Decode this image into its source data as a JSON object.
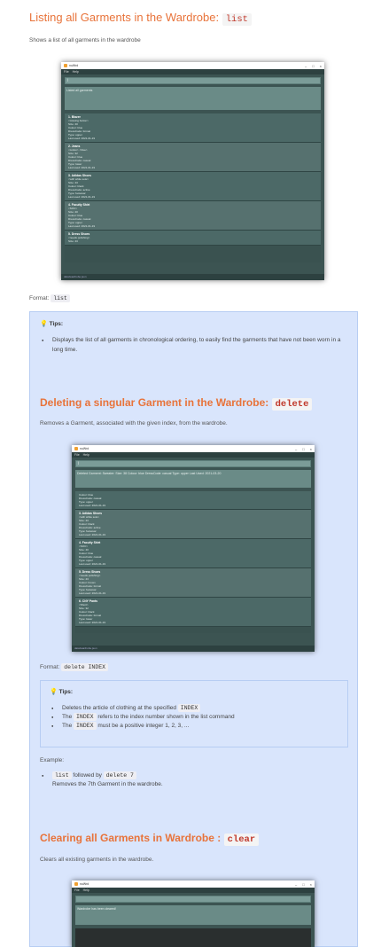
{
  "section_list": {
    "title": "Listing all Garments in the Wardrobe: ",
    "command": "list",
    "description": "Shows a list of all garments in the wardrobe",
    "format_label": "Format:",
    "format_cmd": "list",
    "tips_label": "Tips:",
    "tips": [
      "Displays the list of all garments in chronological ordering, to easily find the garments that have not been worn in a long time."
    ]
  },
  "screenshot_list": {
    "title": "nuWrd",
    "menu": [
      "File",
      "Help"
    ],
    "command_text": "|",
    "result_text": "Listed all garments",
    "cards": [
      {
        "name": "1.  Blazer",
        "lines": [
          "<missing button>",
          "Size: 40",
          "Colour: blue",
          "DressCode: formal",
          "Type: upper",
          "Last used: 2021-01-19"
        ]
      },
      {
        "name": "2.  Jeans",
        "lines": [
          "<cotton> <blue>",
          "Size: 32",
          "Colour: blue",
          "DressCode: casual",
          "Type: lower",
          "Last used: 2021-01-19"
        ]
      },
      {
        "name": "3.  Adidas Shoes",
        "lines": [
          "<with white sole>",
          "Size: 43",
          "Colour: black",
          "DressCode: active",
          "Type: footwear",
          "Last used: 2021-01-19"
        ]
      },
      {
        "name": "4.  Faculty Shirt",
        "lines": [
          "<SOC>",
          "Size: 40",
          "Colour: blue",
          "DressCode: casual",
          "Type: upper",
          "Last used: 2021-01-19"
        ]
      },
      {
        "name": "5.  Dress Shoes",
        "lines": [
          "<needs polishing>",
          "Size: 43"
        ]
      }
    ],
    "status": "data\\wardrobe.json"
  },
  "section_delete": {
    "title": "Deleting a singular Garment in the Wardrobe: ",
    "command": "delete",
    "description": "Removes a Garment, associated with the given index, from the wardrobe.",
    "format_label": "Format:",
    "format_cmd": "delete INDEX",
    "tips_label": "Tips:",
    "tips": [
      {
        "pre": "Deletes the article of clothing at the specified ",
        "code": "INDEX",
        "post": ""
      },
      {
        "pre": "The ",
        "code": "INDEX",
        "post": " refers to the index number shown in the list command"
      },
      {
        "pre": "The ",
        "code": "INDEX",
        "post": " must be a positive integer 1, 2, 3, ..."
      }
    ],
    "example_label": "Example:",
    "example_cmd1": "list",
    "example_mid": " followed by ",
    "example_cmd2": "delete 7",
    "example_desc": "Removes the 7th Garment in the wardrobe."
  },
  "screenshot_delete": {
    "title": "nuWrd",
    "menu": [
      "File",
      "Help"
    ],
    "command_text": "|",
    "result_text": "Deleted Garment: Sweater: Size: 38 Colour: blue DressCode: casual Type: upper Last Used: 2021-03-20",
    "cards": [
      {
        "name": "",
        "lines": [
          "Colour: blue",
          "DressCode: casual",
          "Type: upper",
          "Last used: 2021-01-19"
        ]
      },
      {
        "name": "3.  Adidas Shoes",
        "lines": [
          "<with white sole>",
          "Size: 43",
          "Colour: black",
          "DressCode: active",
          "Type: footwear",
          "Last used: 2021-01-19"
        ]
      },
      {
        "name": "4.  Faculty Shirt",
        "lines": [
          "<SOC>",
          "Size: 40",
          "Colour: blue",
          "DressCode: casual",
          "Type: upper",
          "Last used: 2021-01-19"
        ]
      },
      {
        "name": "5.  Dress Shoes",
        "lines": [
          "<needs polishing>",
          "Size: 43",
          "Colour: brown",
          "DressCode: formal",
          "Type: footwear",
          "Last used: 2021-01-19"
        ]
      },
      {
        "name": "6.  CNY Pants",
        "lines": [
          "<Short>",
          "Size: 32",
          "Colour: black",
          "DressCode: formal",
          "Type: lower",
          "Last used: 2021-01-19"
        ]
      }
    ],
    "status": "data\\wardrobe.json"
  },
  "section_clear": {
    "title": "Clearing all Garments in Wardrobe : ",
    "command": "clear",
    "description": "Clears all existing garments in the wardrobe."
  },
  "screenshot_clear": {
    "title": "nuWrd",
    "menu": [
      "File",
      "Help"
    ],
    "command_text": "",
    "result_text": "Wardrobe has been cleared!"
  },
  "colors": {
    "heading": "#e8733a",
    "code_heading": "#c0392b",
    "tip_background": "#d9e5fc",
    "app_background": "#3c5452"
  }
}
